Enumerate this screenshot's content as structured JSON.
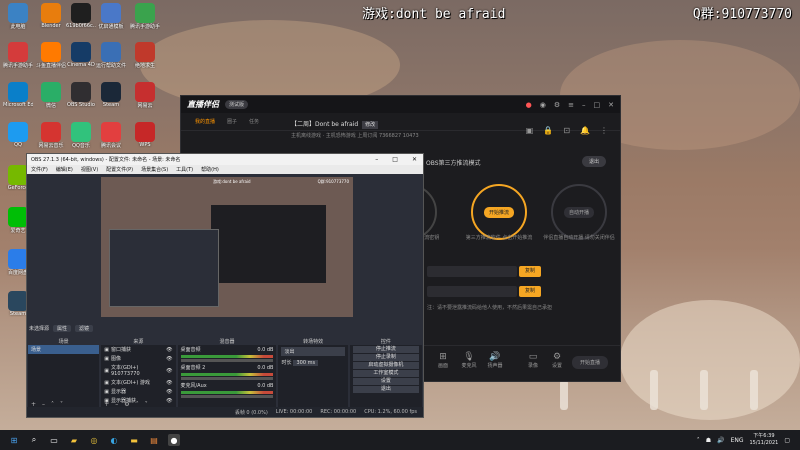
{
  "overlay": {
    "game_title": "游戏:dont be afraid",
    "qq_contact": "Q群:910773770"
  },
  "desktop_icons": [
    {
      "label": "此电脑",
      "icon": "computer-icon",
      "color": "#3b82c4"
    },
    {
      "label": "Blender",
      "icon": "blender-icon",
      "color": "#e87d0d"
    },
    {
      "label": "619b0f66c...",
      "icon": "file-icon",
      "color": "#1f1f1f"
    },
    {
      "label": "优启通模板",
      "icon": "tool-icon",
      "color": "#4a78c8"
    },
    {
      "label": "腾讯手游助手",
      "icon": "game-icon",
      "color": "#3aa34d"
    },
    {
      "label": "腾讯手游助手",
      "icon": "game-icon",
      "color": "#d43b3b"
    },
    {
      "label": "斗鱼直播伴侣",
      "icon": "douyu-icon",
      "color": "#ff7a00"
    },
    {
      "label": "Cinema 4D",
      "icon": "c4d-icon",
      "color": "#153b66"
    },
    {
      "label": "运行帮助文件",
      "icon": "help-icon",
      "color": "#3a6fb5"
    },
    {
      "label": "绝地求生",
      "icon": "pubg-icon",
      "color": "#c0392b"
    },
    {
      "label": "Microsoft Edge",
      "icon": "edge-icon",
      "color": "#0a7fc9"
    },
    {
      "label": "微信",
      "icon": "wechat-icon",
      "color": "#2aae67"
    },
    {
      "label": "OBS Studio",
      "icon": "obs-icon",
      "color": "#302e31"
    },
    {
      "label": "Steam",
      "icon": "steam-icon",
      "color": "#1b2838"
    },
    {
      "label": "网易云",
      "icon": "music-icon",
      "color": "#c62f2f"
    },
    {
      "label": "QQ",
      "icon": "qq-icon",
      "color": "#1d9bf0"
    },
    {
      "label": "网易云音乐",
      "icon": "netease-icon",
      "color": "#d53430"
    },
    {
      "label": "QQ音乐",
      "icon": "qqmusic-icon",
      "color": "#31c27c"
    },
    {
      "label": "腾讯会议",
      "icon": "meeting-icon",
      "color": "#e23f3f"
    },
    {
      "label": "WPS",
      "icon": "wps-icon",
      "color": "#c62828"
    },
    {
      "label": "GeForce",
      "icon": "nvidia-icon",
      "color": "#76b900"
    },
    {
      "label": "爱奇艺",
      "icon": "iqiyi-icon",
      "color": "#00be06"
    },
    {
      "label": "百度网盘",
      "icon": "cloud-icon",
      "color": "#2b7de9"
    },
    {
      "label": "Steam",
      "icon": "steam-icon",
      "color": "#2a475e"
    }
  ],
  "live_app": {
    "logo": "直播伴侣",
    "version_badge": "测试版",
    "tabs": [
      {
        "label": "我的直播",
        "active": true
      },
      {
        "label": "圈子",
        "active": false
      },
      {
        "label": "任务",
        "active": false
      }
    ],
    "room_title": "【二周】Dont be afraid",
    "room_tag": "修改",
    "room_sub": "主机离线游戏 · 主机恐怖游戏   上周订阅 7366827   10473",
    "mode_text": "OBS第三方推流模式",
    "exit_label": "退出",
    "steps": [
      {
        "num": "2",
        "pill": "",
        "text": "复制推流码 推流密钥"
      },
      {
        "num": "3",
        "pill": "开始推流",
        "text": "第三方推流软件 点击开始推流"
      },
      {
        "num": "4",
        "pill": "自动开播",
        "text": "伴侣直播自动开播 请勿关闭伴侣"
      }
    ],
    "copy_label": "复制",
    "warning": "注：请不要泄露推流码给他人使用，不然后果需自己承担",
    "bottom_icons": [
      "画面",
      "麦克风",
      "扬声器",
      "录像",
      "设置"
    ],
    "start_label": "开始直播"
  },
  "obs": {
    "title": "OBS 27.1.3 (64-bit, windows) - 配置文件: 未命名 - 场景: 未命名",
    "menu": [
      "文件(F)",
      "编辑(E)",
      "视图(V)",
      "配置文件(P)",
      "场景集合(S)",
      "工具(T)",
      "帮助(H)"
    ],
    "preview_caption": "游戏:dont be afraid",
    "preview_contact": "Q群:910773770",
    "mid_label": "未选择源",
    "mid_buttons": [
      "属性",
      "滤镜"
    ],
    "docks": {
      "scenes_header": "场景",
      "scenes": [
        "场景"
      ],
      "sources_header": "来源",
      "sources": [
        "窗口捕获",
        "图像",
        "文本(GDI+) 910773770",
        "文本(GDI+) 游戏",
        "显示器",
        "显示器捕获"
      ],
      "mixer_header": "混音器",
      "mixer_tracks": [
        {
          "name": "桌面音频",
          "level": "0.0 dB"
        },
        {
          "name": "桌面音频 2",
          "level": "0.0 dB"
        },
        {
          "name": "麦克风/Aux",
          "level": "0.0 dB"
        }
      ],
      "transition_header": "转场特效",
      "transition_name": "淡出",
      "transition_duration_label": "时长",
      "transition_duration": "300 ms",
      "controls_header": "控件",
      "controls": [
        "停止推流",
        "停止录制",
        "启动虚拟摄像机",
        "工作室模式",
        "设置",
        "退出"
      ]
    },
    "status": [
      "丢帧 0 (0.0%)",
      "LIVE: 00:00:00",
      "REC: 00:00:00",
      "CPU: 1.2%, 60.00 fps"
    ]
  },
  "taskbar": {
    "apps": [
      "windows-start-icon",
      "search-icon",
      "task-view-icon",
      "file-explorer-icon",
      "chrome-icon",
      "edge-icon",
      "folder-icon",
      "store-icon",
      "obs-taskbar-icon"
    ],
    "tray_lang": "ENG",
    "time": "下午6:39",
    "date": "15/11/2021"
  }
}
